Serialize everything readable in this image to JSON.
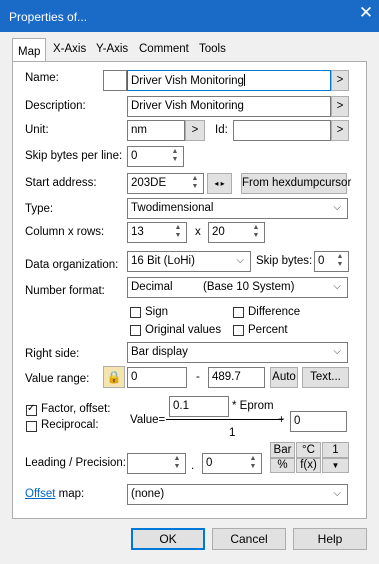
{
  "window": {
    "title": "Properties of..."
  },
  "tabs": [
    "Map",
    "X-Axis",
    "Y-Axis",
    "Comment",
    "Tools"
  ],
  "fields": {
    "name_label": "Name:",
    "name_value": "Driver Vish Monitoring",
    "description_label": "Description:",
    "description_value": "Driver Vish Monitoring",
    "unit_label": "Unit:",
    "unit_value": "nm",
    "id_label": "Id:",
    "id_value": "",
    "skip_bytes_line_label": "Skip bytes per line:",
    "skip_bytes_line_value": "0",
    "start_address_label": "Start address:",
    "start_address_value": "203DE",
    "from_hexdump_label": "From hexdumpcursor",
    "type_label": "Type:",
    "type_value": "Twodimensional",
    "colrows_label": "Column x rows:",
    "columns_value": "13",
    "x_label": "x",
    "rows_value": "20",
    "data_org_label": "Data organization:",
    "data_org_value": "16 Bit (LoHi)",
    "skip_bytes_label": "Skip bytes:",
    "skip_bytes_value": "0",
    "number_format_label": "Number format:",
    "number_format_value": "Decimal",
    "number_format_desc": "(Base 10 System)",
    "sign_label": "Sign",
    "difference_label": "Difference",
    "original_values_label": "Original values",
    "percent_label": "Percent",
    "right_side_label": "Right side:",
    "right_side_value": "Bar display",
    "value_range_label": "Value range:",
    "range_min": "0",
    "range_dash": "-",
    "range_max": "489.7",
    "auto_label": "Auto",
    "text_label": "Text...",
    "factor_offset_label": "Factor, offset:",
    "reciprocal_label": "Reciprocal:",
    "value_eq": "Value=",
    "factor_value": "0.1",
    "eprom_label": "* Eprom",
    "plus": "+",
    "offset_value": "0",
    "denominator": "1",
    "leading_label": "Leading / Precision:",
    "leading_value": "",
    "dot": ".",
    "precision_value": "0",
    "bar_label": "Bar",
    "degc_label": "°C",
    "one_label": "1",
    "pct_label": "%",
    "fx_label": "f(x)",
    "offset_map_link": "Offset",
    "offset_map_suffix": " map:",
    "offset_map_value": "(none)"
  },
  "checkboxes": {
    "sign": false,
    "difference": false,
    "original_values": false,
    "percent": false,
    "factor_offset": true,
    "reciprocal": false
  },
  "buttons": {
    "ok": "OK",
    "cancel": "Cancel",
    "help": "Help"
  },
  "colors": {
    "titlebar": "#1a6ac8",
    "focus": "#0078d7",
    "link": "#0066cc"
  }
}
